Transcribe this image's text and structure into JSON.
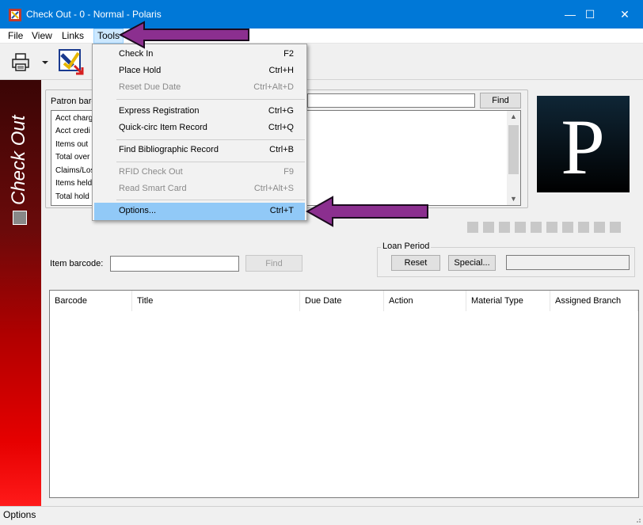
{
  "window": {
    "title": "Check Out - 0 - Normal - Polaris",
    "minimize_glyph": "—",
    "maximize_glyph": "☐",
    "close_glyph": "✕"
  },
  "menubar": {
    "items": [
      {
        "label": "File"
      },
      {
        "label": "View"
      },
      {
        "label": "Links"
      },
      {
        "label": "Tools"
      }
    ]
  },
  "sidebar": {
    "vertical_label": "Check Out"
  },
  "patron": {
    "barcode_label": "Patron barc",
    "find_label": "Find",
    "info_rows": [
      "Acct charg",
      "Acct credi",
      "Items out",
      "Total over",
      "Claims/Los",
      "Items held",
      "Total hold"
    ]
  },
  "logo": {
    "letter": "P"
  },
  "item": {
    "barcode_label": "Item barcode:",
    "find_label": "Find"
  },
  "loan_period": {
    "label": "Loan Period",
    "reset_label": "Reset",
    "special_label": "Special..."
  },
  "grid": {
    "columns": [
      "Barcode",
      "Title",
      "Due Date",
      "Action",
      "Material Type",
      "Assigned Branch"
    ]
  },
  "statusbar": {
    "text": "Options"
  },
  "tools_menu": {
    "items": [
      {
        "label": "Check In",
        "shortcut": "F2",
        "enabled": true
      },
      {
        "label": "Place Hold",
        "shortcut": "Ctrl+H",
        "enabled": true
      },
      {
        "label": "Reset Due Date",
        "shortcut": "Ctrl+Alt+D",
        "enabled": false
      },
      {
        "label": "Express Registration",
        "shortcut": "Ctrl+G",
        "enabled": true
      },
      {
        "label": "Quick-circ Item Record",
        "shortcut": "Ctrl+Q",
        "enabled": true
      },
      {
        "label": "Find Bibliographic Record",
        "shortcut": "Ctrl+B",
        "enabled": true
      },
      {
        "label": "RFID Check Out",
        "shortcut": "F9",
        "enabled": false
      },
      {
        "label": "Read Smart Card",
        "shortcut": "Ctrl+Alt+S",
        "enabled": false
      },
      {
        "label": "Options...",
        "shortcut": "Ctrl+T",
        "enabled": true,
        "highlighted": true
      }
    ]
  },
  "colors": {
    "titlebar": "#0078d7",
    "menu_highlight": "#91c9f7",
    "annotation_arrow": "#8b2f8f",
    "sidebar_red": "#e60000"
  }
}
